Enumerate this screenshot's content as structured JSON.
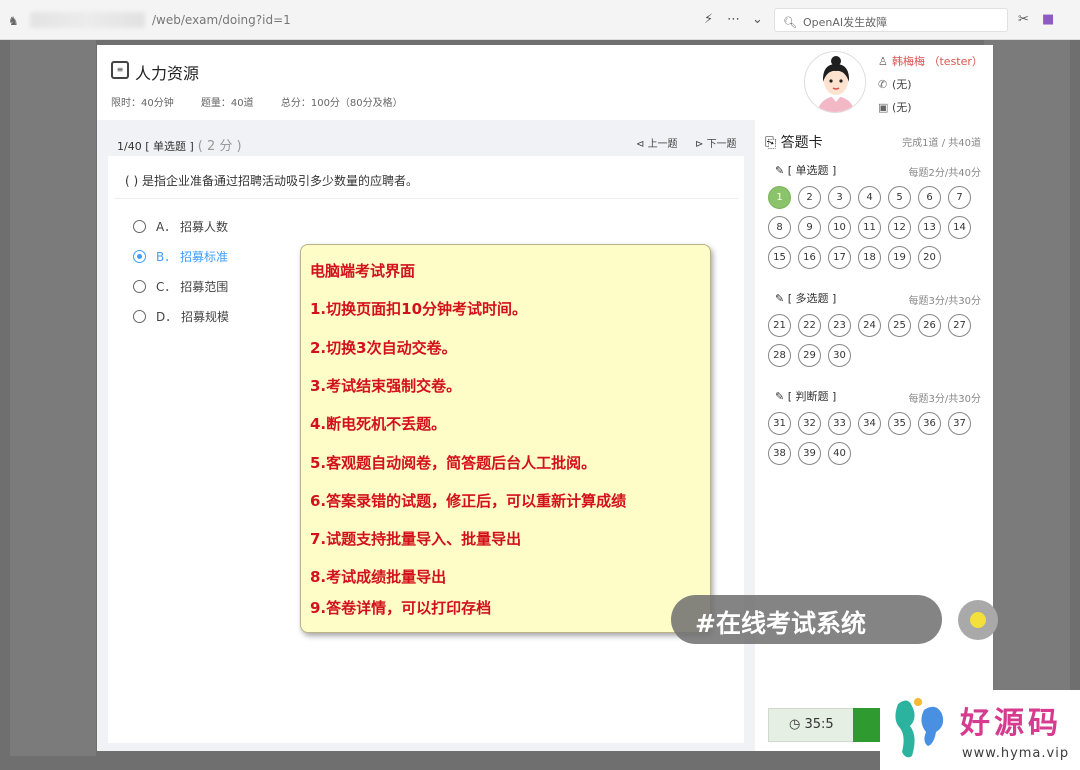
{
  "browser": {
    "url": "/web/exam/doing?id=1",
    "search_text": "OpenAI发生故障",
    "icons": [
      "site-icon",
      "lightning-icon",
      "more-icon",
      "chevron-down-icon",
      "search-icon",
      "cut-icon",
      "extension-icon"
    ]
  },
  "header": {
    "title": "人力资源",
    "time_limit": "限时：40分钟",
    "question_count": "题量：40道",
    "total_score": "总分：100分（80分及格）",
    "user_name": "韩梅梅 （tester）",
    "phone": "(无)",
    "id_card": "(无)"
  },
  "question": {
    "number": "1/40 [ 单选题 ]",
    "score": "( 2 分 )",
    "prev_label": "上一题",
    "next_label": "下一题",
    "text": "(    ) 是指企业准备通过招聘活动吸引多少数量的应聘者。",
    "options": [
      {
        "label": "A．  招募人数",
        "selected": false
      },
      {
        "label": "B．  招募标准",
        "selected": true
      },
      {
        "label": "C．  招募范围",
        "selected": false
      },
      {
        "label": "D．  招募规模",
        "selected": false
      }
    ]
  },
  "answer_card": {
    "title": "答题卡",
    "progress": "完成1道 / 共40道",
    "sections": [
      {
        "title": "[ 单选题 ]",
        "rule": "每题2分/共40分",
        "start": 1,
        "end": 20
      },
      {
        "title": "[ 多选题 ]",
        "rule": "每题3分/共30分",
        "start": 21,
        "end": 30
      },
      {
        "title": "[ 判断题 ]",
        "rule": "每题3分/共30分",
        "start": 31,
        "end": 40
      }
    ],
    "done": [
      1
    ]
  },
  "timer": "35:5",
  "overlay": {
    "lines": [
      "电脑端考试界面",
      "1.切换页面扣10分钟考试时间。",
      "2.切换3次自动交卷。",
      "3.考试结束强制交卷。",
      "4.断电死机不丢题。",
      "5.客观题自动阅卷，简答题后台人工批阅。",
      "6.答案录错的试题，修正后，可以重新计算成绩",
      "7.试题支持批量导入、批量导出",
      "8.考试成绩批量导出",
      "9.答卷详情，可以打印存档"
    ],
    "hashtag": "#在线考试系统",
    "color": "#d3111b"
  },
  "watermark": {
    "text": "好源码",
    "url": "www.hyma.vip"
  }
}
